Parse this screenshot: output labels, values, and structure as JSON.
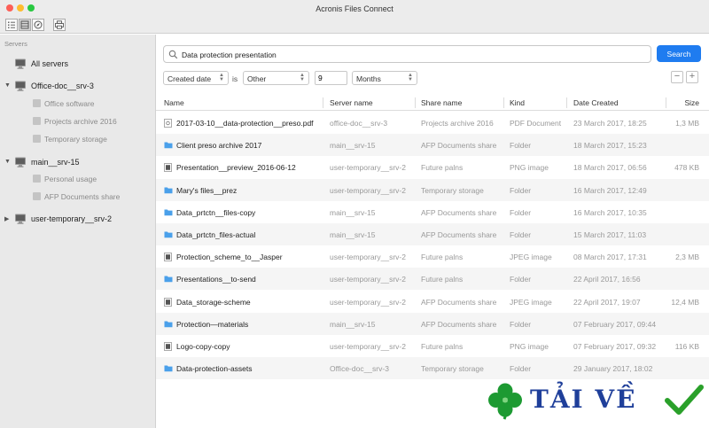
{
  "window": {
    "title": "Acronis Files Connect"
  },
  "sidebar": {
    "heading": "Servers",
    "all_servers": "All servers",
    "groups": [
      {
        "name": "Office-doc__srv-3",
        "expanded": true,
        "items": [
          "Office software",
          "Projects archive 2016",
          "Temporary storage"
        ]
      },
      {
        "name": "main__srv-15",
        "expanded": true,
        "items": [
          "Personal usage",
          "AFP Documents share"
        ]
      },
      {
        "name": "user-temporary__srv-2",
        "expanded": false,
        "items": []
      }
    ]
  },
  "search": {
    "value": "Data protection presentation",
    "button": "Search"
  },
  "filter": {
    "field": "Created date",
    "op_label": "is",
    "condition": "Other",
    "number": "9",
    "unit": "Months",
    "remove": "−",
    "add": "+"
  },
  "table": {
    "columns": [
      "Name",
      "Server name",
      "Share name",
      "Kind",
      "Date Created",
      "Size"
    ],
    "rows": [
      {
        "icon": "pdf-file-icon",
        "name": "2017-03-10__data-protection__preso.pdf",
        "server": "office-doc__srv-3",
        "share": "Projects archive 2016",
        "kind": "PDF Document",
        "date": "23 March 2017, 18:25",
        "size": "1,3 MB"
      },
      {
        "icon": "folder-icon",
        "name": "Client preso archive 2017",
        "server": "main__srv-15",
        "share": "AFP Documents share",
        "kind": "Folder",
        "date": "18 March 2017, 15:23",
        "size": ""
      },
      {
        "icon": "image-file-icon",
        "name": "Presentation__preview_2016-06-12",
        "server": "user-temporary__srv-2",
        "share": "Future palns",
        "kind": "PNG image",
        "date": "18 March 2017, 06:56",
        "size": "478 KB"
      },
      {
        "icon": "folder-icon",
        "name": "Mary's files__prez",
        "server": "user-temporary__srv-2",
        "share": "Temporary storage",
        "kind": "Folder",
        "date": "16 March 2017, 12:49",
        "size": ""
      },
      {
        "icon": "folder-icon",
        "name": "Data_prtctn__files-copy",
        "server": "main__srv-15",
        "share": "AFP Documents share",
        "kind": "Folder",
        "date": "16 March 2017, 10:35",
        "size": ""
      },
      {
        "icon": "folder-icon",
        "name": "Data_prtctn_files-actual",
        "server": "main__srv-15",
        "share": "AFP Documents share",
        "kind": "Folder",
        "date": "15 March 2017, 11:03",
        "size": ""
      },
      {
        "icon": "image-file-icon",
        "name": "Protection_scheme_to__Jasper",
        "server": "user-temporary__srv-2",
        "share": "Future palns",
        "kind": "JPEG image",
        "date": "08 March 2017, 17:31",
        "size": "2,3 MB"
      },
      {
        "icon": "folder-icon",
        "name": "Presentations__to-send",
        "server": "user-temporary__srv-2",
        "share": "Future palns",
        "kind": "Folder",
        "date": "22 April 2017, 16:56",
        "size": ""
      },
      {
        "icon": "image-file-icon",
        "name": "Data_storage-scheme",
        "server": "user-temporary__srv-2",
        "share": "AFP Documents share",
        "kind": "JPEG image",
        "date": "22 April 2017, 19:07",
        "size": "12,4 MB"
      },
      {
        "icon": "folder-icon",
        "name": "Protection—materials",
        "server": "main__srv-15",
        "share": "AFP Documents share",
        "kind": "Folder",
        "date": "07 February 2017, 09:44",
        "size": ""
      },
      {
        "icon": "image-file-icon",
        "name": "Logo-copy-copy",
        "server": "user-temporary__srv-2",
        "share": "Future palns",
        "kind": "PNG image",
        "date": "07 February 2017, 09:32",
        "size": "116 KB"
      },
      {
        "icon": "folder-icon",
        "name": "Data-protection-assets",
        "server": "Office-doc__srv-3",
        "share": "Temporary storage",
        "kind": "Folder",
        "date": "29 January 2017, 18:02",
        "size": ""
      }
    ]
  },
  "watermark": {
    "text": "TẢI VỀ"
  },
  "colors": {
    "accent": "#1f7cf0",
    "folder": "#4aa0ea",
    "watermark_text": "#1f3f9a",
    "watermark_clover": "#1d9a32",
    "watermark_check": "#2aa02a"
  }
}
